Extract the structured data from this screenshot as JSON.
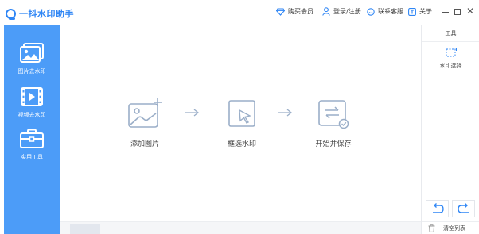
{
  "app": {
    "title": "一抖水印助手"
  },
  "titlebar": {
    "vip": "购买会员",
    "login": "登录/注册",
    "service": "联系客服",
    "about": "关于"
  },
  "sidebar": {
    "items": [
      {
        "label": "图片去水印",
        "icon": "image-icon"
      },
      {
        "label": "视频去水印",
        "icon": "video-icon"
      },
      {
        "label": "实用工具",
        "icon": "toolbox-icon"
      }
    ]
  },
  "main": {
    "steps": [
      {
        "label": "添加图片",
        "icon": "add-image-icon"
      },
      {
        "label": "框选水印",
        "icon": "select-area-icon"
      },
      {
        "label": "开始并保存",
        "icon": "process-save-icon"
      }
    ]
  },
  "panel": {
    "title": "工具",
    "tool_label": "水印选择",
    "clear_label": "清空列表"
  },
  "colors": {
    "accent": "#2f86f5",
    "sidebar_bg": "#4c9cf8",
    "step_icon": "#9aaec8"
  }
}
